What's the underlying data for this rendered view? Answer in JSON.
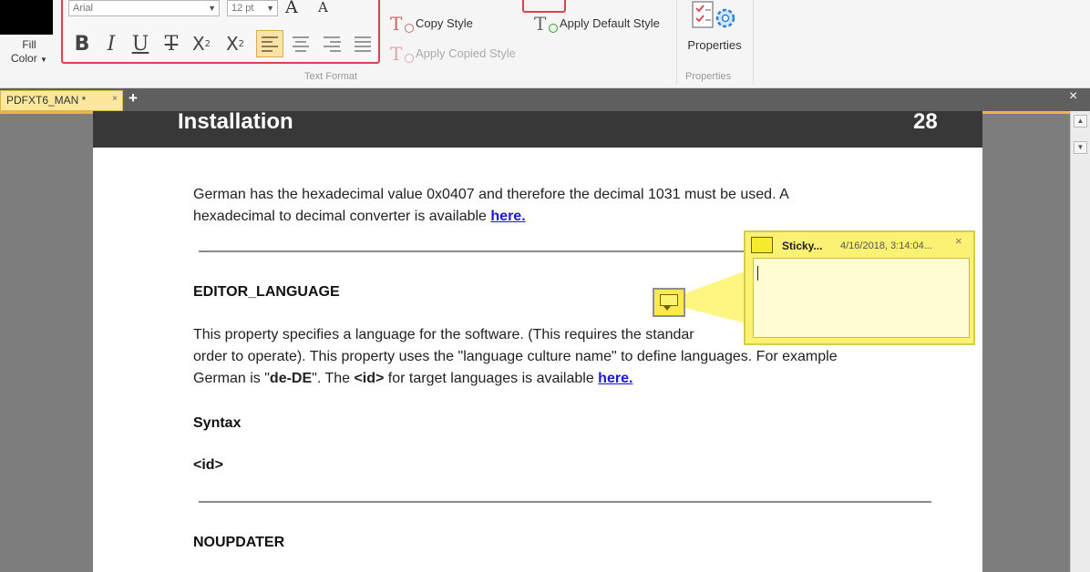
{
  "ribbon": {
    "fill_color": {
      "line1": "Fill",
      "line2": "Color",
      "swatch": "#000000"
    },
    "text_format": {
      "font_name": "Arial",
      "font_size": "12 pt",
      "grow_font": "A",
      "shrink_font": "A",
      "bold": "B",
      "italic": "I",
      "underline": "U",
      "strikethrough": "T",
      "subscript": "X",
      "superscript": "X",
      "sub_mark": "2",
      "sup_mark": "2",
      "group_label": "Text Format",
      "accent": "#d9434f"
    },
    "styles": {
      "copy_style": "Copy Style",
      "apply_copied_style": "Apply Copied Style",
      "apply_default_style": "Apply Default Style"
    },
    "properties": {
      "label": "Properties",
      "group_label": "Properties"
    }
  },
  "tabs": {
    "document_tab": "PDFXT6_MAN *",
    "close_glyph": "×",
    "add_glyph": "+",
    "window_close_glyph": "×"
  },
  "page": {
    "title": "Installation",
    "number": "28",
    "para1": "German has the hexadecimal value 0x0407 and therefore the decimal 1031 must be used. A",
    "para1b": "hexadecimal to decimal converter is available ",
    "link1": "here.",
    "heading1": "EDITOR_LANGUAGE",
    "para2a": "This property specifies a language for the software. (This requires the standar",
    "para2b": "order to operate). This property uses the \"language culture name\" to define languages. For example",
    "para2c_pre": "German is \"",
    "para2c_bold": "de-DE",
    "para2c_mid": "\". The ",
    "para2c_bold2": "<id>",
    "para2c_post": " for target languages is available ",
    "link2": "here.",
    "syntax_heading": "Syntax",
    "syntax_value": "<id>",
    "heading2": "NOUPDATER"
  },
  "sticky_note": {
    "title": "Sticky...",
    "date": "4/16/2018, 3:14:04...",
    "close_glyph": "×",
    "text": ""
  },
  "icons": {
    "note": "sticky-note-icon",
    "properties": "properties-icon"
  },
  "colors": {
    "tab_active": "#fce89c",
    "note_yellow": "#fbf173",
    "link": "#1a1ad0"
  }
}
